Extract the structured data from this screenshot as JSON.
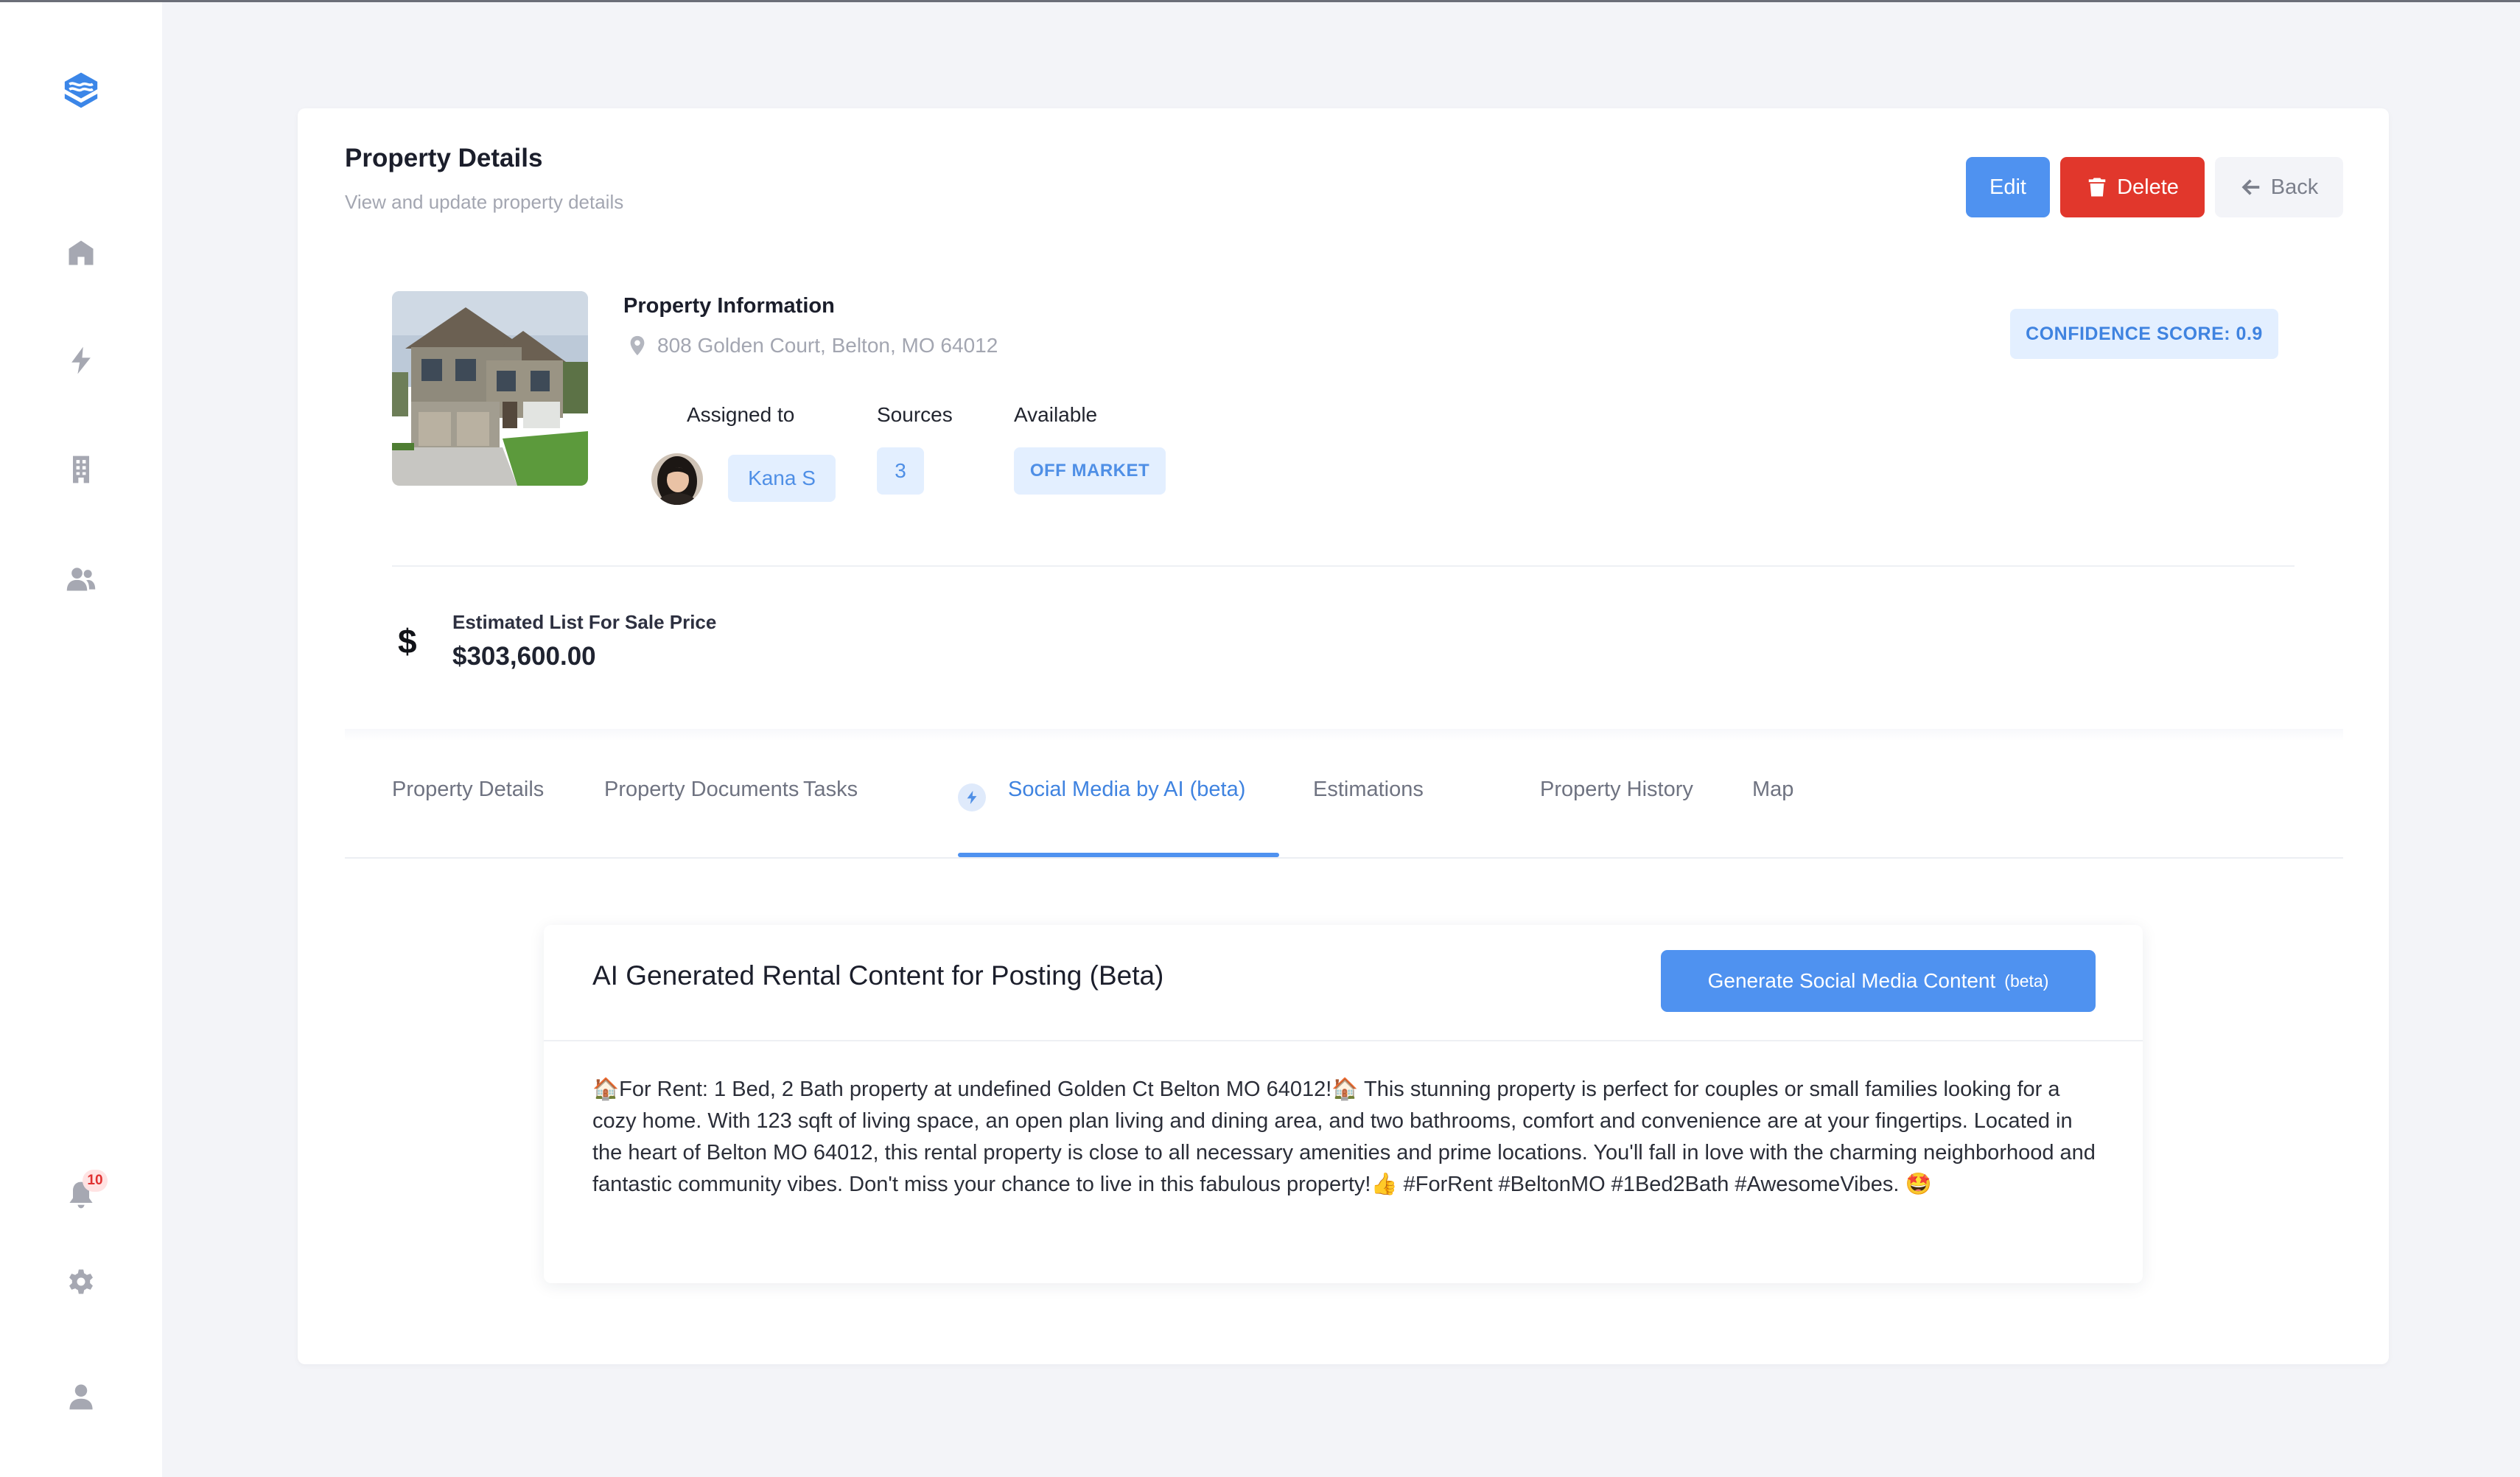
{
  "sidebar": {
    "icons": [
      "layers-logo-icon",
      "home-icon",
      "bolt-icon",
      "building-icon",
      "users-icon",
      "bell-icon",
      "gear-icon",
      "user-icon"
    ],
    "notification_count": "10"
  },
  "header": {
    "title": "Property Details",
    "subtitle": "View and update property details",
    "edit_label": "Edit",
    "delete_label": "Delete",
    "back_label": "Back"
  },
  "property": {
    "section_title": "Property Information",
    "address": "808 Golden Court, Belton, MO 64012",
    "assigned_label": "Assigned to",
    "assigned_name": "Kana S",
    "sources_label": "Sources",
    "sources_count": "3",
    "available_label": "Available",
    "available_status": "OFF MARKET",
    "confidence": "CONFIDENCE SCORE: 0.9",
    "price_symbol": "$",
    "price_label": "Estimated List For Sale Price",
    "price_value": "$303,600.00"
  },
  "tabs": [
    {
      "label": "Property Details"
    },
    {
      "label": "Property Documents"
    },
    {
      "label": "Tasks"
    },
    {
      "label": "Social Media by AI (beta)",
      "active": true
    },
    {
      "label": "Estimations"
    },
    {
      "label": "Property History"
    },
    {
      "label": "Map"
    }
  ],
  "ai_panel": {
    "title": "AI Generated Rental Content for Posting (Beta)",
    "generate_label": "Generate Social Media Content",
    "generate_beta": "(beta)",
    "content": "🏠For Rent: 1 Bed, 2 Bath property at undefined Golden Ct Belton MO 64012!🏠 This stunning property is perfect for couples or small families looking for a cozy home. With 123 sqft of living space, an open plan living and dining area, and two bathrooms, comfort and convenience are at your fingertips. Located in the heart of Belton MO 64012, this rental property is close to all necessary amenities and prime locations. You'll fall in love with the charming neighborhood and fantastic community vibes. Don't miss your chance to live in this fabulous property!👍 #ForRent #BeltonMO #1Bed2Bath #AwesomeVibes. 🤩"
  },
  "colors": {
    "primary": "#4f92f0",
    "danger": "#e1372c",
    "pill_bg": "#e3efff",
    "pill_text": "#4f8fe6"
  }
}
